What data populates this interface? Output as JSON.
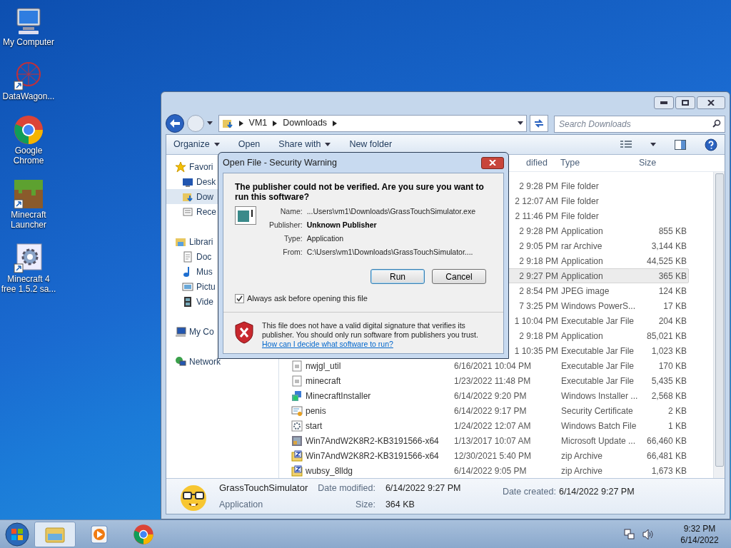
{
  "desktop_icons": [
    {
      "label": "My Computer",
      "kind": "computer"
    },
    {
      "label": "DataWagon...",
      "kind": "web"
    },
    {
      "label": "Google Chrome",
      "kind": "chrome"
    },
    {
      "label": "Minecraft Launcher",
      "kind": "grass"
    },
    {
      "label": "Minecraft 4 free 1.5.2 sa...",
      "kind": "setup"
    }
  ],
  "explorer": {
    "address": [
      "VM1",
      "Downloads"
    ],
    "search": {
      "placeholder": "Search Downloads"
    },
    "toolbar": [
      "Organize",
      "Open",
      "Share with",
      "New folder"
    ],
    "sidebar": [
      {
        "label": "Favori",
        "kind": "star",
        "selected": false,
        "children": [
          {
            "label": "Desk",
            "kind": "desktop",
            "selected": false
          },
          {
            "label": "Dow",
            "kind": "download",
            "selected": true
          },
          {
            "label": "Rece",
            "kind": "recent",
            "selected": false
          }
        ]
      },
      {
        "label": "Librari",
        "kind": "library",
        "selected": false,
        "children": [
          {
            "label": "Doc",
            "kind": "document",
            "selected": false
          },
          {
            "label": "Mus",
            "kind": "music",
            "selected": false
          },
          {
            "label": "Pictu",
            "kind": "picture",
            "selected": false
          },
          {
            "label": "Vide",
            "kind": "video",
            "selected": false
          }
        ]
      },
      {
        "label": "My Co",
        "kind": "computer",
        "selected": false
      },
      {
        "label": "Network",
        "kind": "network",
        "selected": false
      }
    ],
    "columns": [
      "dified",
      "Type",
      "Size"
    ],
    "rows": [
      {
        "date": "2 9:28 PM",
        "type": "File folder",
        "selected": false
      },
      {
        "date": "2 12:07 AM",
        "type": "File folder",
        "selected": false
      },
      {
        "date": "2 11:46 PM",
        "type": "File folder",
        "selected": false
      },
      {
        "date": "2 9:28 PM",
        "type": "Application",
        "size": "855 KB",
        "selected": false
      },
      {
        "date": "2 9:05 PM",
        "type": "rar Archive",
        "size": "3,144 KB",
        "selected": false
      },
      {
        "date": "2 9:18 PM",
        "type": "Application",
        "size": "44,525 KB",
        "selected": false
      },
      {
        "date": "2 9:27 PM",
        "type": "Application",
        "size": "365 KB",
        "selected": true
      },
      {
        "date": "2 8:54 PM",
        "type": "JPEG image",
        "size": "124 KB",
        "selected": false
      },
      {
        "date": "7 3:25 PM",
        "type": "Windows PowerS...",
        "size": "17 KB",
        "selected": false
      },
      {
        "date": "1 10:04 PM",
        "type": "Executable Jar File",
        "size": "204 KB",
        "selected": false
      },
      {
        "date": "2 9:18 PM",
        "type": "Application",
        "size": "85,021 KB",
        "selected": false
      },
      {
        "date": "1 10:35 PM",
        "type": "Executable Jar File",
        "size": "1,023 KB",
        "selected": false
      },
      {
        "name": "nwjgl_util",
        "kind": "jar",
        "date": "6/16/2021 10:04 PM",
        "type": "Executable Jar File",
        "size": "170 KB",
        "selected": false
      },
      {
        "name": "minecraft",
        "kind": "jar",
        "date": "1/23/2022 11:48 PM",
        "type": "Executable Jar File",
        "size": "5,435 KB",
        "selected": false
      },
      {
        "name": "MinecraftInstaller",
        "kind": "installer",
        "date": "6/14/2022 9:20 PM",
        "type": "Windows Installer ...",
        "size": "2,568 KB",
        "selected": false
      },
      {
        "name": "penis",
        "kind": "certificate",
        "date": "6/14/2022 9:17 PM",
        "type": "Security Certificate",
        "size": "2 KB",
        "selected": false
      },
      {
        "name": "start",
        "kind": "batch",
        "date": "1/24/2022 12:07 AM",
        "type": "Windows Batch File",
        "size": "1 KB",
        "selected": false
      },
      {
        "name": "Win7AndW2K8R2-KB3191566-x64",
        "kind": "update",
        "date": "1/13/2017 10:07 AM",
        "type": "Microsoft Update ...",
        "size": "66,460 KB",
        "selected": false
      },
      {
        "name": "Win7AndW2K8R2-KB3191566-x64",
        "kind": "zip",
        "date": "12/30/2021 5:40 PM",
        "type": "zip Archive",
        "size": "66,481 KB",
        "selected": false
      },
      {
        "name": "wubsy_8lldg",
        "kind": "zip",
        "date": "6/14/2022 9:05 PM",
        "type": "zip Archive",
        "size": "1,673 KB",
        "selected": false
      }
    ],
    "details": {
      "name": "GrassTouchSimulator",
      "type": "Application",
      "modified_label": "Date modified:",
      "modified": "6/14/2022 9:27 PM",
      "size_label": "Size:",
      "size": "364 KB",
      "created_label": "Date created:",
      "created": "6/14/2022 9:27 PM"
    }
  },
  "dialog": {
    "title": "Open File - Security Warning",
    "heading": "The publisher could not be verified.  Are you sure you want to run this software?",
    "fields": [
      {
        "label": "Name:",
        "value": "...Users\\vm1\\Downloads\\GrassTouchSimulator.exe",
        "bold": false
      },
      {
        "label": "Publisher:",
        "value": "Unknown Publisher",
        "bold": true
      },
      {
        "label": "Type:",
        "value": "Application",
        "bold": false
      },
      {
        "label": "From:",
        "value": "C:\\Users\\vm1\\Downloads\\GrassTouchSimulator....",
        "bold": false
      }
    ],
    "buttons": [
      "Run",
      "Cancel"
    ],
    "always_ask": {
      "label": "Always ask before opening this file",
      "checked": true
    },
    "warning": "This file does not have a valid digital signature that verifies its publisher.  You should only run software from publishers you trust.",
    "link": "How can I decide what software to run?"
  },
  "taskbar": {
    "apps": [
      {
        "kind": "explorer",
        "selected": true
      },
      {
        "kind": "media",
        "selected": false
      },
      {
        "kind": "chrome",
        "selected": false
      }
    ],
    "time": "9:32 PM",
    "date": "6/14/2022"
  }
}
